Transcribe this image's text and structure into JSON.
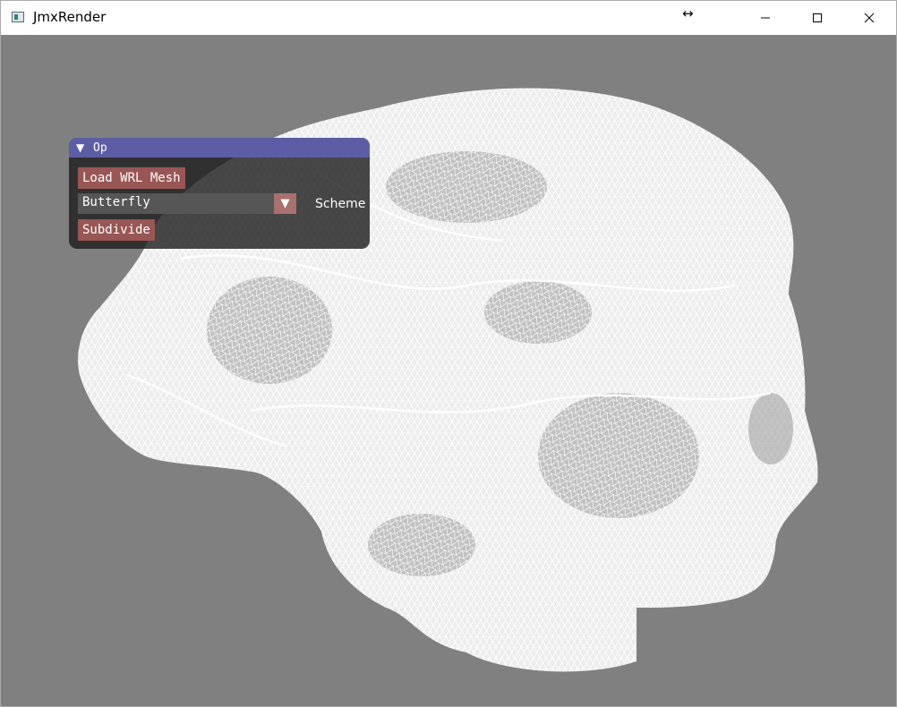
{
  "window": {
    "title": "JmxRender",
    "resize_glyph": "↔",
    "controls": {
      "minimize": "minimize-icon",
      "maximize": "maximize-icon",
      "close": "close-icon"
    }
  },
  "panel": {
    "toggle": "▼",
    "title": "Op",
    "load_button": "Load WRL Mesh",
    "scheme_value": "Butterfly",
    "scheme_arrow": "▼",
    "scheme_label": "Scheme",
    "subdivide_button": "Subdivide"
  },
  "colors": {
    "viewport_background": "#808080",
    "mesh": "#ffffff",
    "panel_header": "#5d5da6",
    "button": "#985655",
    "combo_background": "#565656",
    "combo_arrow": "#a8706f"
  },
  "viewport": {
    "content": "white wireframe mesh of a human head"
  }
}
